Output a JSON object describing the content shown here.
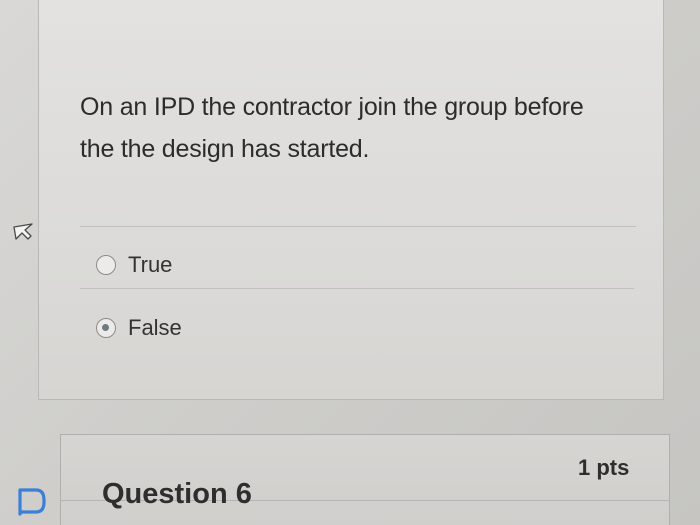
{
  "question": {
    "text_line1": "On an IPD the contractor join the group before",
    "text_line2": "the the design has started.",
    "answers": [
      {
        "label": "True",
        "selected": false
      },
      {
        "label": "False",
        "selected": true
      }
    ]
  },
  "next_question": {
    "title": "Question 6",
    "points": "1 pts"
  },
  "icons": {
    "pointer": "mouse-pointer-icon",
    "flag": "flag-question-icon"
  },
  "colors": {
    "accent_flag": "#3b7fd6",
    "radio_fill": "#6f7a80"
  }
}
